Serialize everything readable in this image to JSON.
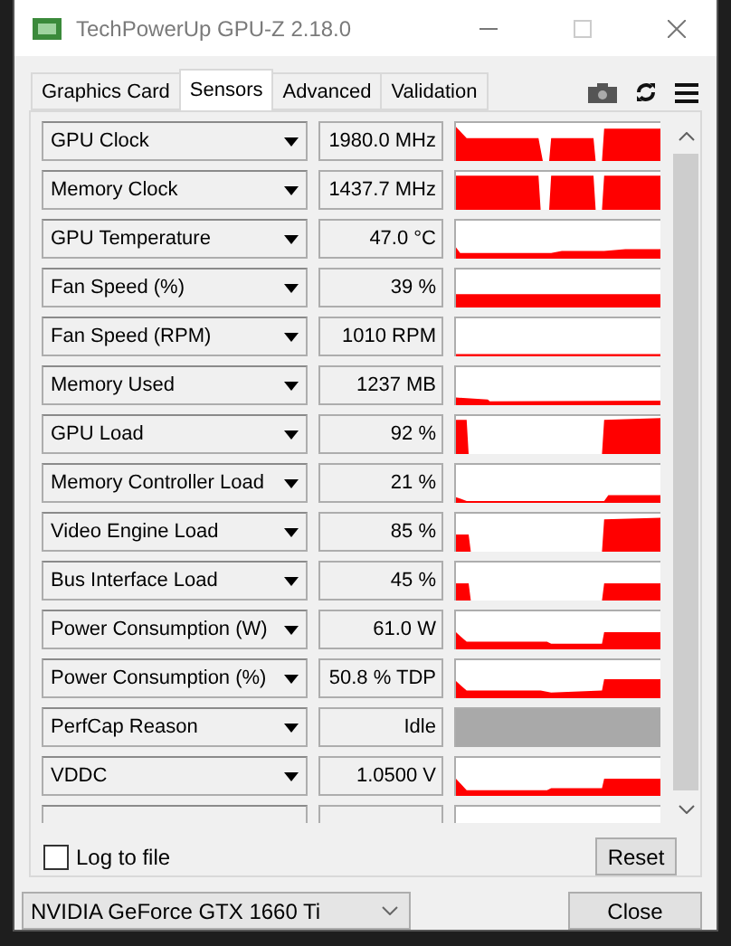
{
  "window": {
    "title": "TechPowerUp GPU-Z 2.18.0"
  },
  "tabs": [
    {
      "label": "Graphics Card",
      "selected": false
    },
    {
      "label": "Sensors",
      "selected": true
    },
    {
      "label": "Advanced",
      "selected": false
    },
    {
      "label": "Validation",
      "selected": false
    }
  ],
  "sensors": [
    {
      "name": "GPU Clock",
      "value": "1980.0 MHz",
      "kind": "graph"
    },
    {
      "name": "Memory Clock",
      "value": "1437.7 MHz",
      "kind": "graph"
    },
    {
      "name": "GPU Temperature",
      "value": "47.0 °C",
      "kind": "graph"
    },
    {
      "name": "Fan Speed (%)",
      "value": "39 %",
      "kind": "graph"
    },
    {
      "name": "Fan Speed (RPM)",
      "value": "1010 RPM",
      "kind": "graph"
    },
    {
      "name": "Memory Used",
      "value": "1237 MB",
      "kind": "graph"
    },
    {
      "name": "GPU Load",
      "value": "92 %",
      "kind": "graph"
    },
    {
      "name": "Memory Controller Load",
      "value": "21 %",
      "kind": "graph"
    },
    {
      "name": "Video Engine Load",
      "value": "85 %",
      "kind": "graph"
    },
    {
      "name": "Bus Interface Load",
      "value": "45 %",
      "kind": "graph"
    },
    {
      "name": "Power Consumption (W)",
      "value": "61.0 W",
      "kind": "graph"
    },
    {
      "name": "Power Consumption (%)",
      "value": "50.8 % TDP",
      "kind": "graph"
    },
    {
      "name": "PerfCap Reason",
      "value": "Idle",
      "kind": "status"
    },
    {
      "name": "VDDC",
      "value": "1.0500 V",
      "kind": "graph"
    },
    {
      "kind": "cut"
    }
  ],
  "log_to_file": {
    "label": "Log to file",
    "checked": false
  },
  "reset_button": "Reset",
  "gpu_select": {
    "value": "NVIDIA GeForce GTX 1660 Ti"
  },
  "close_button": "Close"
}
